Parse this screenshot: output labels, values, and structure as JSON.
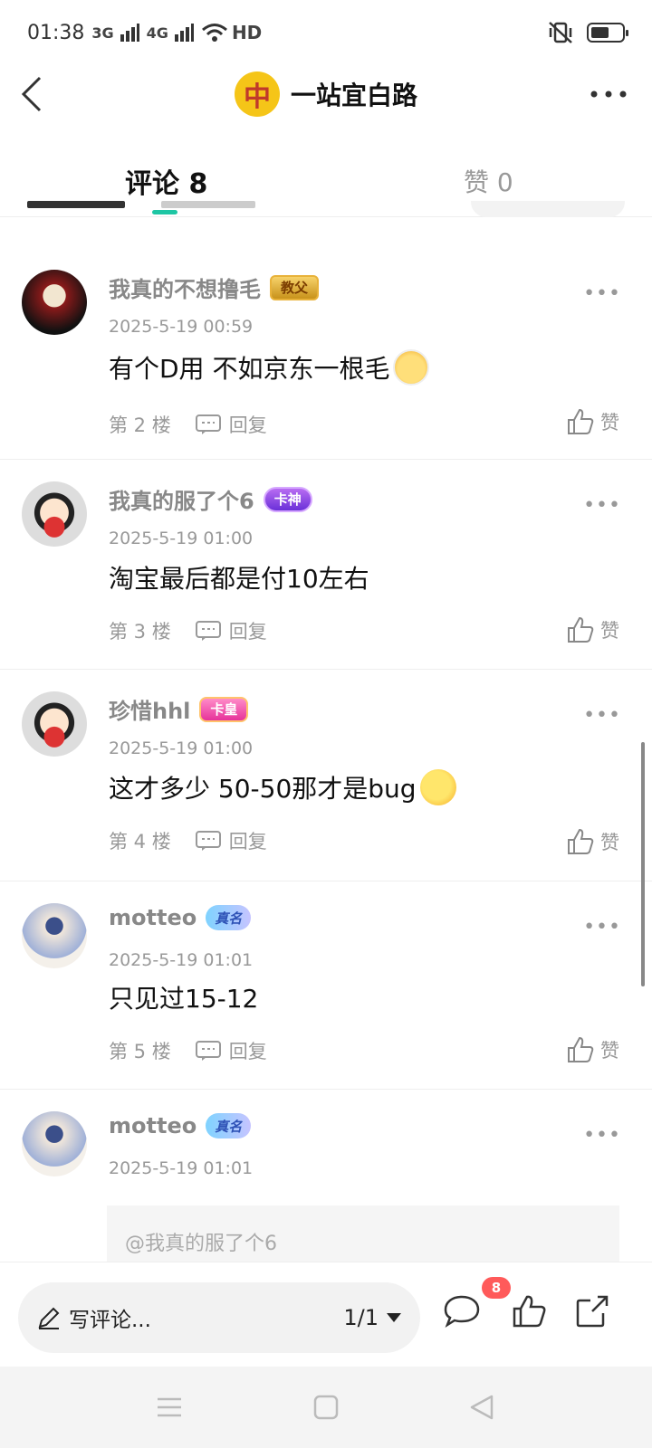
{
  "status_bar": {
    "time": "01:38",
    "signal_1": "3G",
    "signal_2": "4G",
    "network": "HD",
    "battery_level": 0.6
  },
  "header": {
    "logo_char": "中",
    "title": "一站宜白路"
  },
  "tabs": {
    "comments_label": "评论",
    "comments_count": "8",
    "likes_label": "赞",
    "likes_count": "0"
  },
  "comments": [
    {
      "username": "我真的不想撸毛",
      "badge": "教父",
      "date": "2025-5-19 00:59",
      "text": "有个D用  不如京东一根毛",
      "emoji": "cat-emoji",
      "floor": "第 2 楼",
      "reply": "回复",
      "like": "赞"
    },
    {
      "username": "我真的服了个6",
      "badge": "卡神",
      "date": "2025-5-19 01:00",
      "text": "淘宝最后都是付10左右",
      "floor": "第 3 楼",
      "reply": "回复",
      "like": "赞"
    },
    {
      "username": "珍惜hhl",
      "badge": "卡皇",
      "date": "2025-5-19 01:00",
      "text": "这才多少  50-50那才是bug",
      "emoji": "thinking-emoji",
      "floor": "第 4 楼",
      "reply": "回复",
      "like": "赞"
    },
    {
      "username": "motteo",
      "badge": "真名",
      "date": "2025-5-19 01:01",
      "text": "只见过15-12",
      "floor": "第 5 楼",
      "reply": "回复",
      "like": "赞"
    },
    {
      "username": "motteo",
      "badge": "真名",
      "date": "2025-5-19 01:01",
      "quote": "@我真的服了个6"
    }
  ],
  "bottom_bar": {
    "input_placeholder": "写评论...",
    "pager": "1/1",
    "comment_badge_count": "8"
  },
  "colors": {
    "accent": "#1ec6a4",
    "badge_red": "#ff5a5a"
  }
}
